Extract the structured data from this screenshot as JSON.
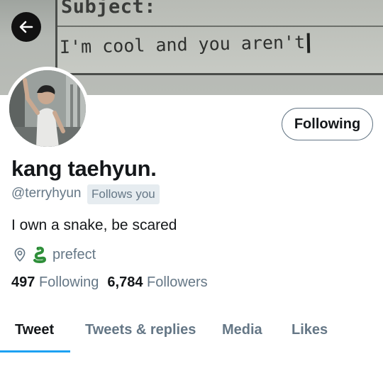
{
  "banner": {
    "subject_text": "Subject:",
    "line_text": "I'm cool and you aren't"
  },
  "back_icon": "arrow-left-icon",
  "profile": {
    "display_name": "kang taehyun.",
    "handle": "@terryhyun",
    "follows_you": "Follows you",
    "bio": "I own a snake, be scared",
    "location": "prefect",
    "location_icon": "map-pin-icon",
    "location_emoji": "snake-emoji",
    "following_button": "Following",
    "stats": {
      "following_count": "497",
      "following_label": "Following",
      "followers_count": "6,784",
      "followers_label": "Followers"
    }
  },
  "tabs": [
    {
      "label": "Tweet",
      "active": true
    },
    {
      "label": "Tweets & replies",
      "active": false
    },
    {
      "label": "Media",
      "active": false
    },
    {
      "label": "Likes",
      "active": false
    }
  ],
  "colors": {
    "accent": "#1da1f2",
    "secondary_text": "#657786",
    "primary_text": "#14171a",
    "badge_bg": "#e6ecf0"
  }
}
